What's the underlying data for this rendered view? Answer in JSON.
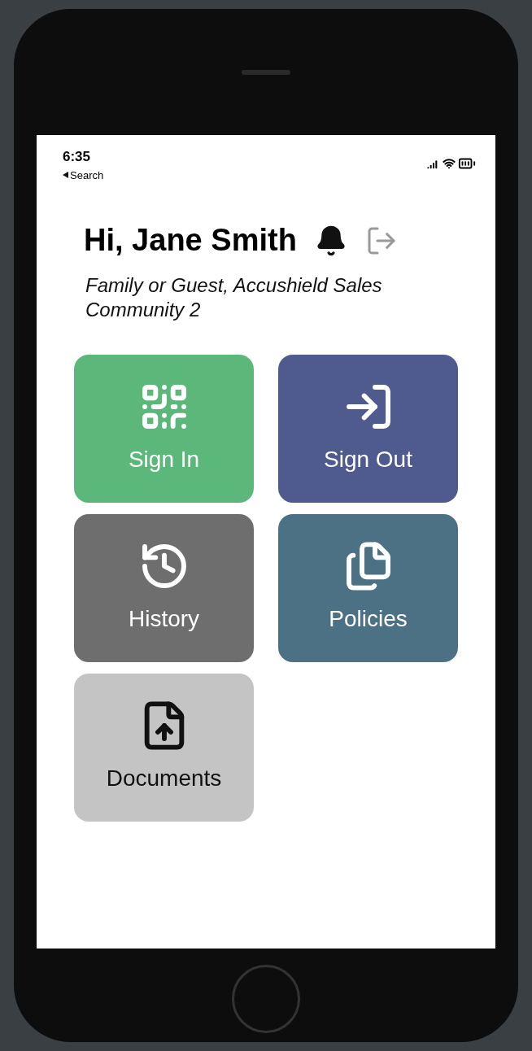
{
  "status_bar": {
    "time": "6:35",
    "back_label": "Search"
  },
  "header": {
    "greeting": "Hi, Jane Smith",
    "subtitle": "Family or Guest, Accushield Sales Community 2"
  },
  "tiles": [
    {
      "label": "Sign In",
      "kind": "qr",
      "color": "#5cb87a",
      "dark_text": false
    },
    {
      "label": "Sign Out",
      "kind": "enter",
      "color": "#4f5a8f",
      "dark_text": false
    },
    {
      "label": "History",
      "kind": "history",
      "color": "#6e6e6e",
      "dark_text": false
    },
    {
      "label": "Policies",
      "kind": "files",
      "color": "#4c7184",
      "dark_text": false
    },
    {
      "label": "Documents",
      "kind": "upload",
      "color": "#c4c4c4",
      "dark_text": true
    }
  ]
}
